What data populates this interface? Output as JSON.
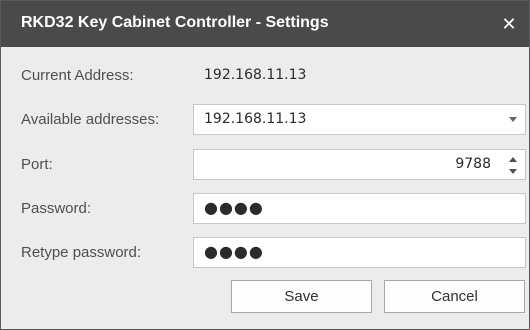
{
  "window": {
    "title": "RKD32 Key Cabinet Controller - Settings",
    "close_icon": "✕",
    "close_icon_name": "close-icon"
  },
  "fields": {
    "current_address": {
      "label": "Current Address:",
      "value": "192.168.11.13"
    },
    "available_addresses": {
      "label": "Available addresses:",
      "selected": "192.168.11.13"
    },
    "port": {
      "label": "Port:",
      "value": "9788"
    },
    "password": {
      "label": "Password:",
      "value": "●●●●"
    },
    "retype_password": {
      "label": "Retype password:",
      "value": "●●●●"
    }
  },
  "buttons": {
    "save": "Save",
    "cancel": "Cancel"
  },
  "colors": {
    "titlebar": "#4a4a4a",
    "background": "#ececec",
    "field_border": "#c6c6c6",
    "text": "#4f4f4f"
  }
}
